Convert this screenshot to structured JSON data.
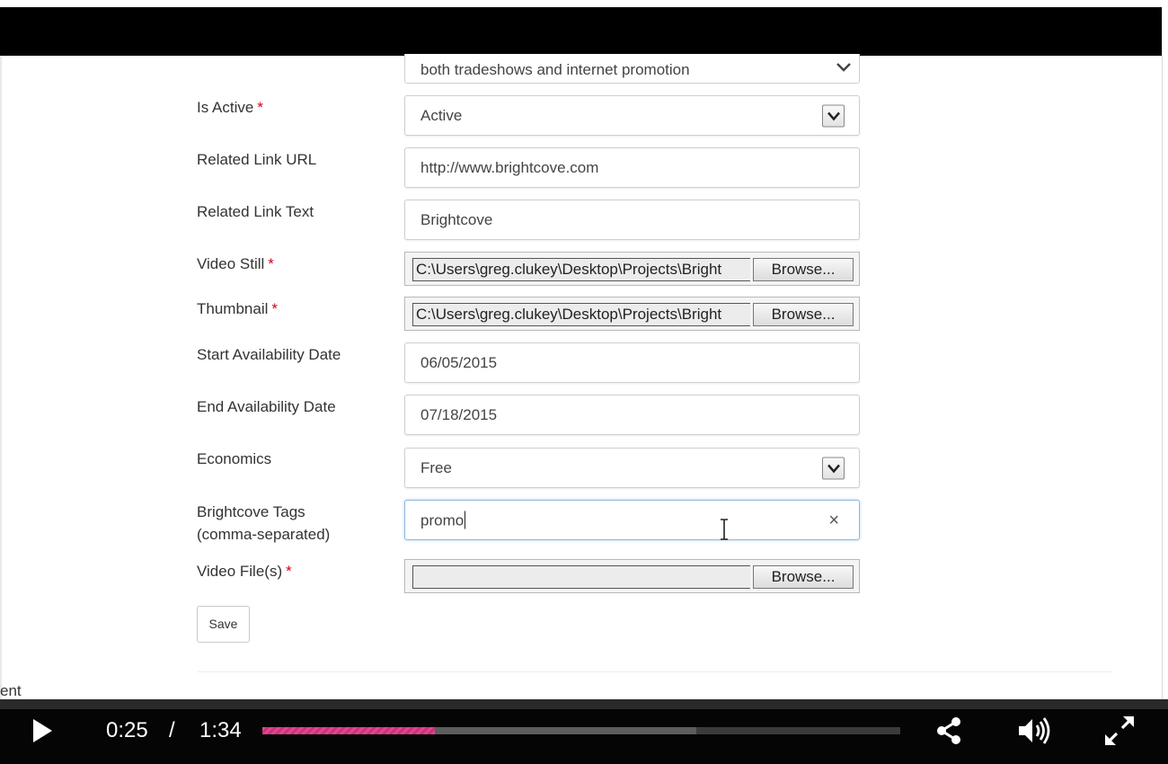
{
  "form": {
    "description_tail": "both tradeshows and internet promotion",
    "required_marker": "*",
    "fields": {
      "is_active": {
        "label": "Is Active",
        "value": "Active"
      },
      "related_link_url": {
        "label": "Related Link URL",
        "value": "http://www.brightcove.com"
      },
      "related_link_text": {
        "label": "Related Link Text",
        "value": "Brightcove"
      },
      "video_still": {
        "label": "Video Still",
        "value": "C:\\Users\\greg.clukey\\Desktop\\Projects\\Bright",
        "button": "Browse..."
      },
      "thumbnail": {
        "label": "Thumbnail",
        "value": "C:\\Users\\greg.clukey\\Desktop\\Projects\\Bright",
        "button": "Browse..."
      },
      "start_date": {
        "label": "Start Availability Date",
        "value": "06/05/2015"
      },
      "end_date": {
        "label": "End Availability Date",
        "value": "07/18/2015"
      },
      "economics": {
        "label": "Economics",
        "value": "Free"
      },
      "tags": {
        "label_line1": "Brightcove Tags",
        "label_line2": "(comma-separated)",
        "value": "promo",
        "clear": "×"
      },
      "video_files": {
        "label": "Video File(s)",
        "value": "",
        "button": "Browse..."
      }
    },
    "save_label": "Save",
    "partial_text": "ent"
  },
  "player": {
    "current_time": "0:25",
    "separator": "/",
    "duration": "1:34",
    "progress_played_fraction": 0.27,
    "progress_buffered_fraction": 0.68,
    "played_color": "#e0468f"
  },
  "icons": {
    "play": "play-icon",
    "share": "share-icon",
    "volume": "volume-icon",
    "fullscreen": "fullscreen-icon",
    "select_arrow": "chevron-down-icon",
    "clear": "close-icon",
    "cursor": "text-cursor-icon"
  }
}
